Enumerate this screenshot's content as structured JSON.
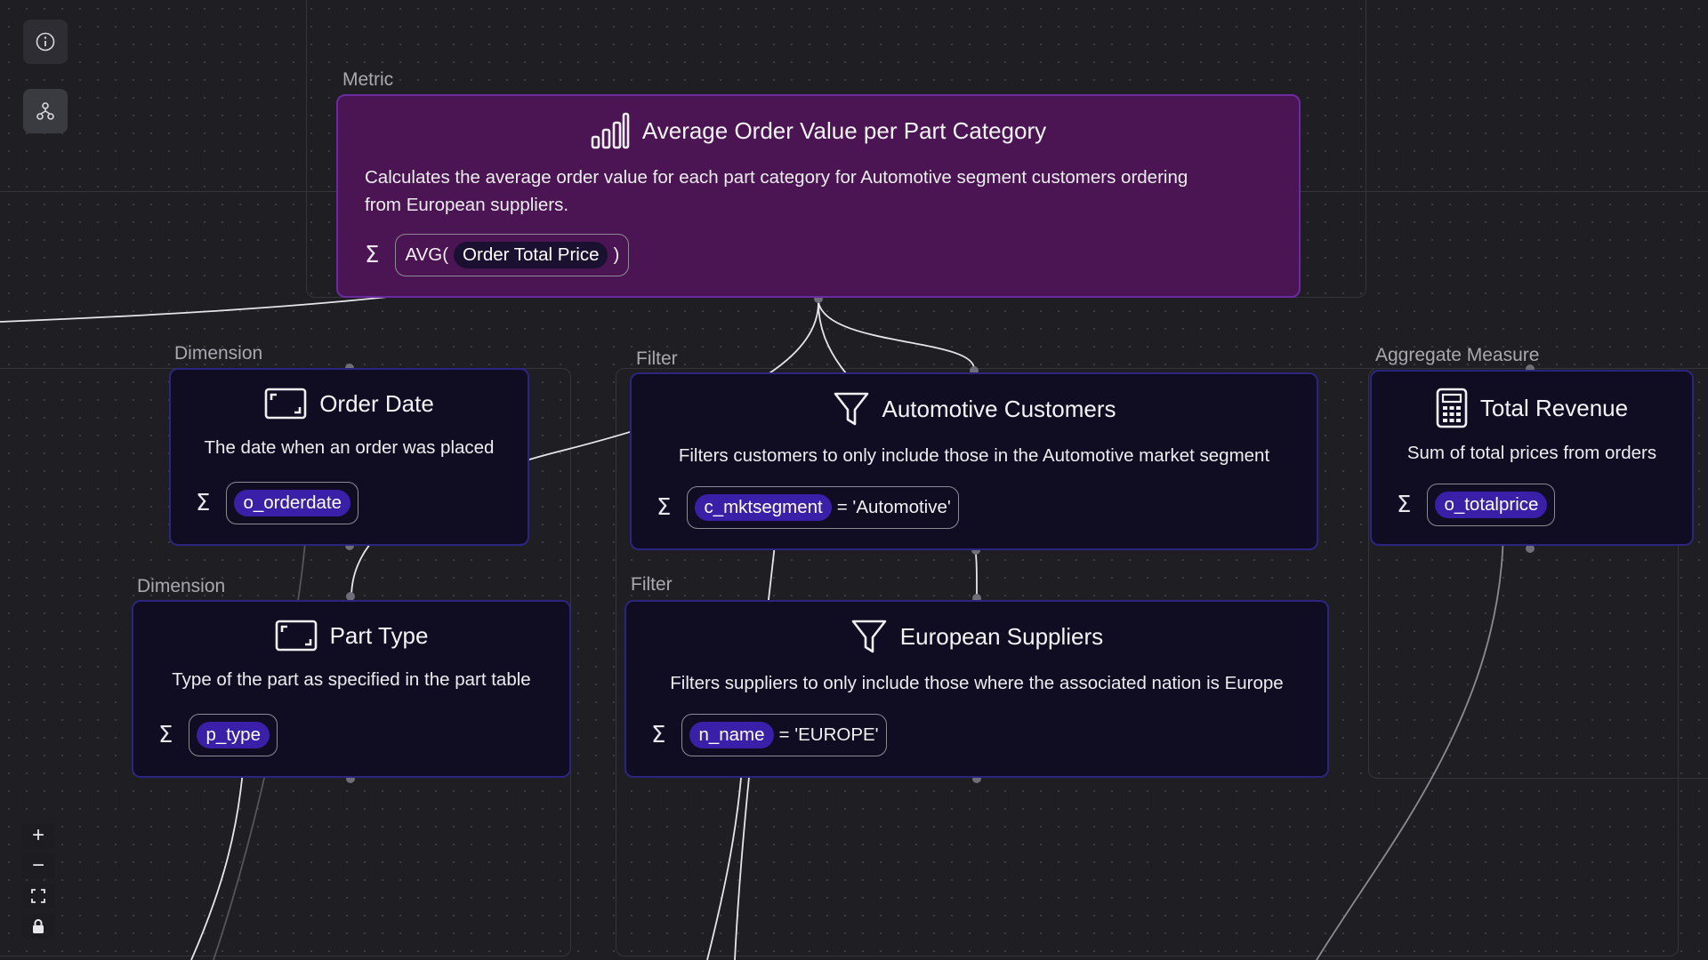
{
  "nodes": {
    "metric": {
      "type_label": "Metric",
      "title": "Average Order Value per Part Category",
      "description_line1": "Calculates the average order value for each part category for Automotive segment customers ordering",
      "description_line2": "from European suppliers.",
      "expr_func_open": "AVG(",
      "expr_field": "Order Total Price",
      "expr_func_close": ")"
    },
    "order_date": {
      "type_label": "Dimension",
      "title": "Order Date",
      "description": "The date when an order was placed",
      "field": "o_orderdate"
    },
    "part_type": {
      "type_label": "Dimension",
      "title": "Part Type",
      "description": "Type of the part as specified in the part table",
      "field": "p_type"
    },
    "automotive": {
      "type_label": "Filter",
      "title": "Automotive Customers",
      "description": "Filters customers to only include those in the Automotive market segment",
      "field": "c_mktsegment",
      "condition": "= 'Automotive'"
    },
    "european": {
      "type_label": "Filter",
      "title": "European Suppliers",
      "description": "Filters suppliers to only include those where the associated nation is Europe",
      "field": "n_name",
      "condition": "= 'EUROPE'"
    },
    "revenue": {
      "type_label": "Aggregate Measure",
      "title": "Total Revenue",
      "description": "Sum of total prices from orders",
      "field": "o_totalprice"
    }
  },
  "sigma_symbol": "Σ",
  "toolbar": {
    "info_icon": "info-icon",
    "layout_icon": "hierarchy-icon"
  },
  "zoom_controls": {
    "zoom_in": "+",
    "zoom_out": "−",
    "fit": "fit-view-icon",
    "lock": "lock-icon"
  },
  "colors": {
    "canvas": "#1f1f23",
    "node_bg": "#100d22",
    "node_border": "#2c2580",
    "metric_bg": "#4a1552",
    "metric_border": "#6a2aa0",
    "pill": "#3a20a8"
  }
}
